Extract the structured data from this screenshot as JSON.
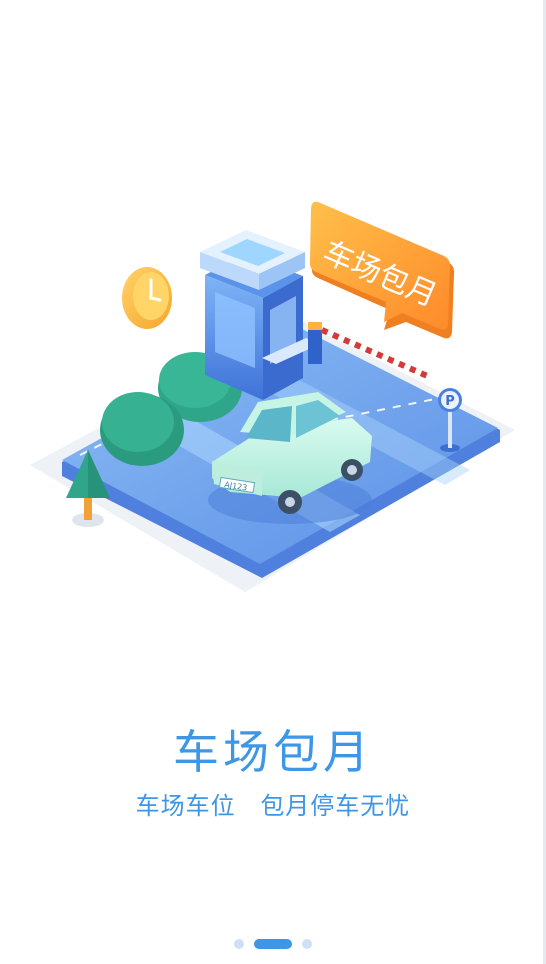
{
  "illustration": {
    "sign_text": "车场包月",
    "plate_text": "AJ123"
  },
  "headline": "车场包月",
  "subtitle": {
    "part1": "车场车位",
    "part2": "包月停车无忧"
  },
  "pager": {
    "count": 3,
    "active_index": 1
  },
  "colors": {
    "accent": "#3d96e6",
    "sign_orange": "#ff9f2e",
    "platform_blue": "#6ea2ee"
  }
}
